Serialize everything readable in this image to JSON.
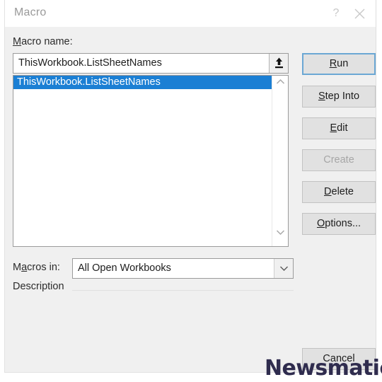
{
  "dialog": {
    "title": "Macro",
    "help_icon": "question-mark-icon",
    "close_icon": "close-icon"
  },
  "macro_name": {
    "label_accel": "M",
    "label_rest": "acro name:",
    "value": "ThisWorkbook.ListSheetNames",
    "upload_icon": "upload-arrow-icon"
  },
  "list": {
    "items": [
      {
        "label": "ThisWorkbook.ListSheetNames",
        "selected": true
      }
    ],
    "scroll_up_icon": "chevron-up-icon",
    "scroll_down_icon": "chevron-down-icon"
  },
  "macros_in": {
    "label_accel": "M",
    "label_mid": "a",
    "label_rest": "cros in:",
    "label_full": "Macros in:",
    "value": "All Open Workbooks",
    "options": [
      "All Open Workbooks"
    ],
    "arrow_icon": "chevron-down-icon"
  },
  "description": {
    "label": "Description",
    "text": ""
  },
  "buttons": {
    "run": {
      "accel": "R",
      "rest": "un",
      "full": "Run",
      "state": "default-focused"
    },
    "step_into": {
      "accel": "S",
      "rest": "tep Into",
      "full": "Step Into",
      "state": "enabled"
    },
    "edit": {
      "accel": "E",
      "rest": "dit",
      "full": "Edit",
      "state": "enabled"
    },
    "create": {
      "accel": "C",
      "rest": "reate",
      "full": "Create",
      "state": "disabled"
    },
    "delete": {
      "accel": "D",
      "rest": "elete",
      "full": "Delete",
      "state": "enabled"
    },
    "options": {
      "accel": "O",
      "rest": "ptions...",
      "full": "Options...",
      "state": "enabled"
    },
    "cancel": {
      "full": "Cancel",
      "state": "enabled"
    }
  },
  "watermark": {
    "text": "Newsmatic",
    "color": "#2f2c4e"
  },
  "colors": {
    "selection_blue": "#1b7fd4",
    "focus_border": "#6ba7d4",
    "dialog_bg": "#f0f0f0",
    "titlebar_bg": "#ffffff",
    "button_bg": "#e1e1e1",
    "title_text": "#9a9a9a"
  }
}
